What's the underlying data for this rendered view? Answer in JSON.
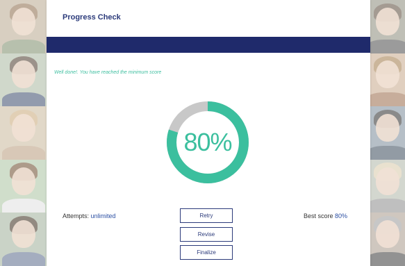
{
  "header": {
    "title": "Progress Check"
  },
  "result": {
    "message": "Well done!. You have reached the minimum score",
    "score_label": "80%",
    "score_fraction": 0.8
  },
  "footer": {
    "attempts_label": "Attempts: ",
    "attempts_value": "unlimited",
    "best_label": "Best score ",
    "best_value": "80%"
  },
  "buttons": {
    "retry": "Retry",
    "revise": "Revise",
    "finalize": "Finalize"
  },
  "colors": {
    "accent": "#3bbf9e",
    "track": "#c8c8c8",
    "banner": "#1f2a6b",
    "title": "#2b3a7a"
  },
  "background": {
    "left_tiles": 5,
    "right_tiles": 5
  }
}
